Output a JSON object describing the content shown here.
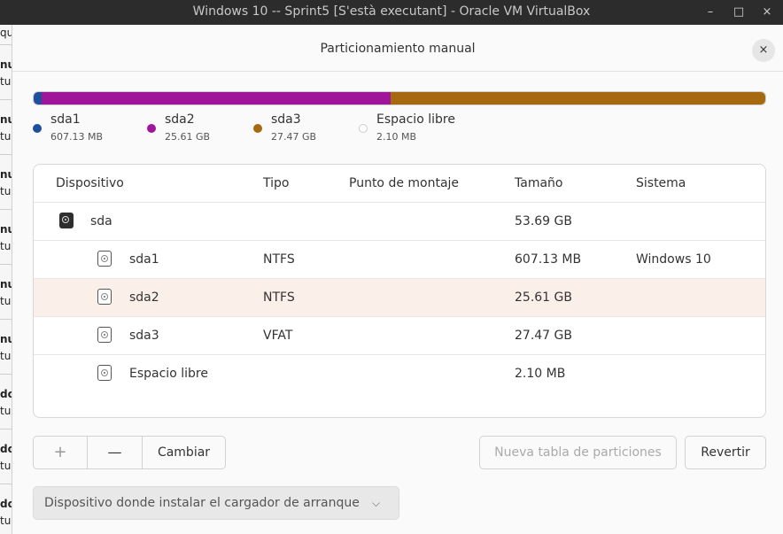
{
  "window": {
    "title": "Windows 10 -- Sprint5 [S'està executant] - Oracle VM VirtualBox",
    "minimize": "–",
    "maximize": "□",
    "close": "×"
  },
  "background_fragments": [
    "qu",
    "nu",
    "tu",
    "nu",
    "tu",
    "nu",
    "tu",
    "nu",
    "tu",
    "nu",
    "tu",
    "nu",
    "tu",
    "do",
    "tu",
    "do",
    "tu",
    "do",
    "tu"
  ],
  "dialog": {
    "title": "Particionamiento manual",
    "close": "×"
  },
  "partition_bar": {
    "colors": {
      "sda1": "#1f4e9c",
      "sda2": "#a0169a",
      "sda3": "#a6690f",
      "free": "#ffffff"
    },
    "fractions": [
      0.0113,
      0.477,
      0.5116,
      0.0001
    ]
  },
  "legend": [
    {
      "name": "sda1",
      "size": "607.13 MB",
      "color": "#1f4e9c"
    },
    {
      "name": "sda2",
      "size": "25.61 GB",
      "color": "#a0169a"
    },
    {
      "name": "sda3",
      "size": "27.47 GB",
      "color": "#a6690f"
    },
    {
      "name": "Espacio libre",
      "size": "2.10 MB",
      "color": "#ffffff"
    }
  ],
  "table": {
    "headers": {
      "device": "Dispositivo",
      "type": "Tipo",
      "mount": "Punto de montaje",
      "size": "Tamaño",
      "system": "Sistema"
    },
    "rows": [
      {
        "device": "sda",
        "type": "",
        "mount": "",
        "size": "53.69 GB",
        "system": "",
        "icon": "disk-icon",
        "selected": false
      },
      {
        "device": "sda1",
        "type": "NTFS",
        "mount": "",
        "size": "607.13 MB",
        "system": "Windows 10",
        "icon": "partition-icon",
        "selected": false
      },
      {
        "device": "sda2",
        "type": "NTFS",
        "mount": "",
        "size": "25.61 GB",
        "system": "",
        "icon": "partition-icon",
        "selected": true
      },
      {
        "device": "sda3",
        "type": "VFAT",
        "mount": "",
        "size": "27.47 GB",
        "system": "",
        "icon": "partition-icon",
        "selected": false
      },
      {
        "device": "Espacio libre",
        "type": "",
        "mount": "",
        "size": "2.10 MB",
        "system": "",
        "icon": "partition-icon",
        "selected": false
      }
    ]
  },
  "buttons": {
    "add": "+",
    "remove": "—",
    "change": "Cambiar",
    "new_table": "Nueva tabla de particiones",
    "revert": "Revertir"
  },
  "bootloader": {
    "label": "Dispositivo donde instalar el cargador de arranque",
    "chevron": "⌵"
  }
}
